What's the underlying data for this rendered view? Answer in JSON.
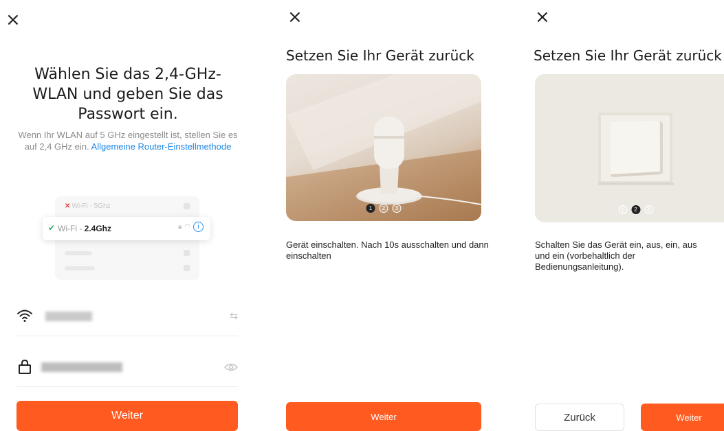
{
  "screens": [
    {
      "close_icon": "×",
      "title": "Wählen Sie das 2,4-GHz-WLAN und geben Sie das Passwort ein.",
      "description": "Wenn Ihr WLAN auf 5 GHz eingestellt ist, stellen Sie es auf 2,4 GHz ein.",
      "link_text": "Allgemeine Router-Einstellmethode",
      "illustration": {
        "bad_network_prefix": "Wi-Fi - ",
        "bad_network_band": "5Ghz",
        "good_network_prefix": "Wi-Fi - ",
        "good_network_band": "2.4Ghz"
      },
      "wifi_field_icon": "wifi-icon",
      "switch_icon": "⇆",
      "password_field_icon": "lock-icon",
      "eye_icon": "◉",
      "button_label": "Weiter"
    },
    {
      "close_icon": "×",
      "title": "Setzen Sie Ihr Gerät zurück",
      "steps": [
        "1",
        "2",
        "3"
      ],
      "active_step": 1,
      "description": "Gerät einschalten. Nach 10s ausschalten und dann einschalten",
      "button_label": "Weiter"
    },
    {
      "close_icon": "×",
      "title": "Setzen Sie Ihr Gerät zurück",
      "steps": [
        "1",
        "2",
        "3"
      ],
      "active_step": 2,
      "description": "Schalten Sie das Gerät ein, aus, ein, aus und ein (vorbehaltlich der Bedienungsanleitung).",
      "back_label": "Zurück",
      "button_label": "Weiter"
    }
  ],
  "colors": {
    "accent": "#ff5a1f",
    "link": "#1e88e5",
    "success": "#1db36a",
    "error": "#ef3a3a"
  }
}
